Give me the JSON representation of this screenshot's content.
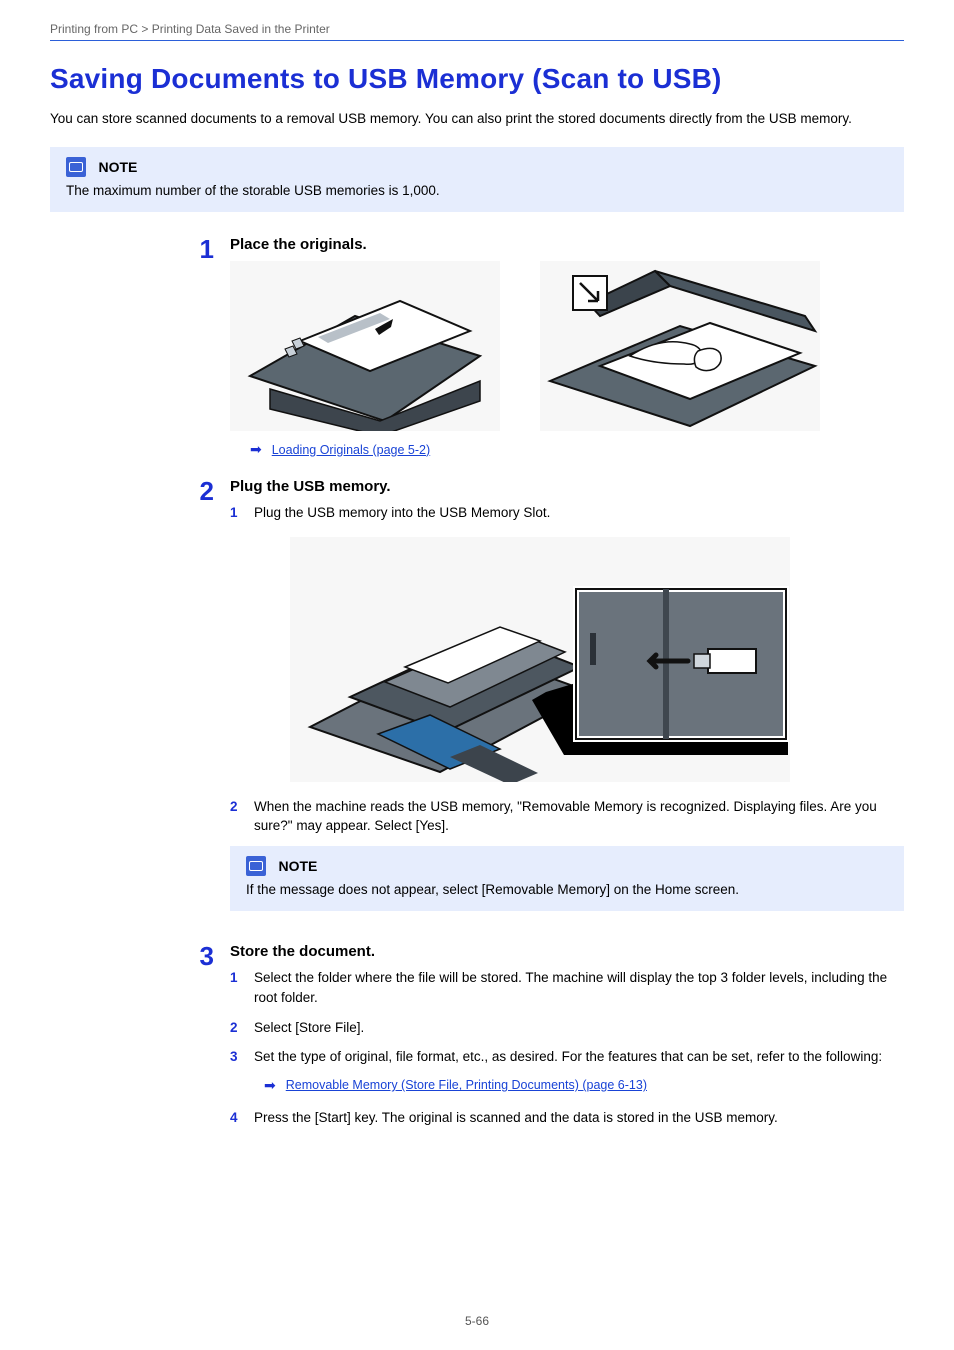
{
  "header": {
    "left": "Printing from PC > Printing Data Saved in the Printer",
    "right": ""
  },
  "title": "Saving Documents to USB Memory (Scan to USB)",
  "intro": "You can store scanned documents to a removal USB memory. You can also print the stored documents directly from the USB memory.",
  "note_top": {
    "label": "NOTE",
    "body": "The maximum number of the storable USB memories is 1,000."
  },
  "steps": [
    {
      "num": "1",
      "title": "Place the originals.",
      "xref": "Loading Originals (page 5-2)"
    },
    {
      "num": "2",
      "title": "Plug the USB memory.",
      "subs": [
        {
          "num": "1",
          "body": "Plug the USB memory into the USB Memory Slot."
        },
        {
          "num": "2",
          "body": "When the machine reads the USB memory, \"Removable Memory is recognized. Displaying files. Are you sure?\" may appear. Select [Yes]."
        }
      ],
      "note": {
        "label": "NOTE",
        "body": "If the message does not appear, select [Removable Memory] on the Home screen."
      }
    },
    {
      "num": "3",
      "title": "Store the document.",
      "subs": [
        {
          "num": "1",
          "body": "Select the folder where the file will be stored. The machine will display the top 3 folder levels, including the root folder."
        },
        {
          "num": "2",
          "body": "Select [Store File]."
        },
        {
          "num": "3",
          "body": "Set the type of original, file format, etc., as desired. For the features that can be set, refer to the following:"
        },
        {
          "num": "4",
          "body": "Press the [Start] key. The original is scanned and the data is stored in the USB memory."
        }
      ],
      "xref": "Removable Memory (Store File, Printing Documents) (page 6-13)"
    }
  ],
  "footer": "5-66"
}
